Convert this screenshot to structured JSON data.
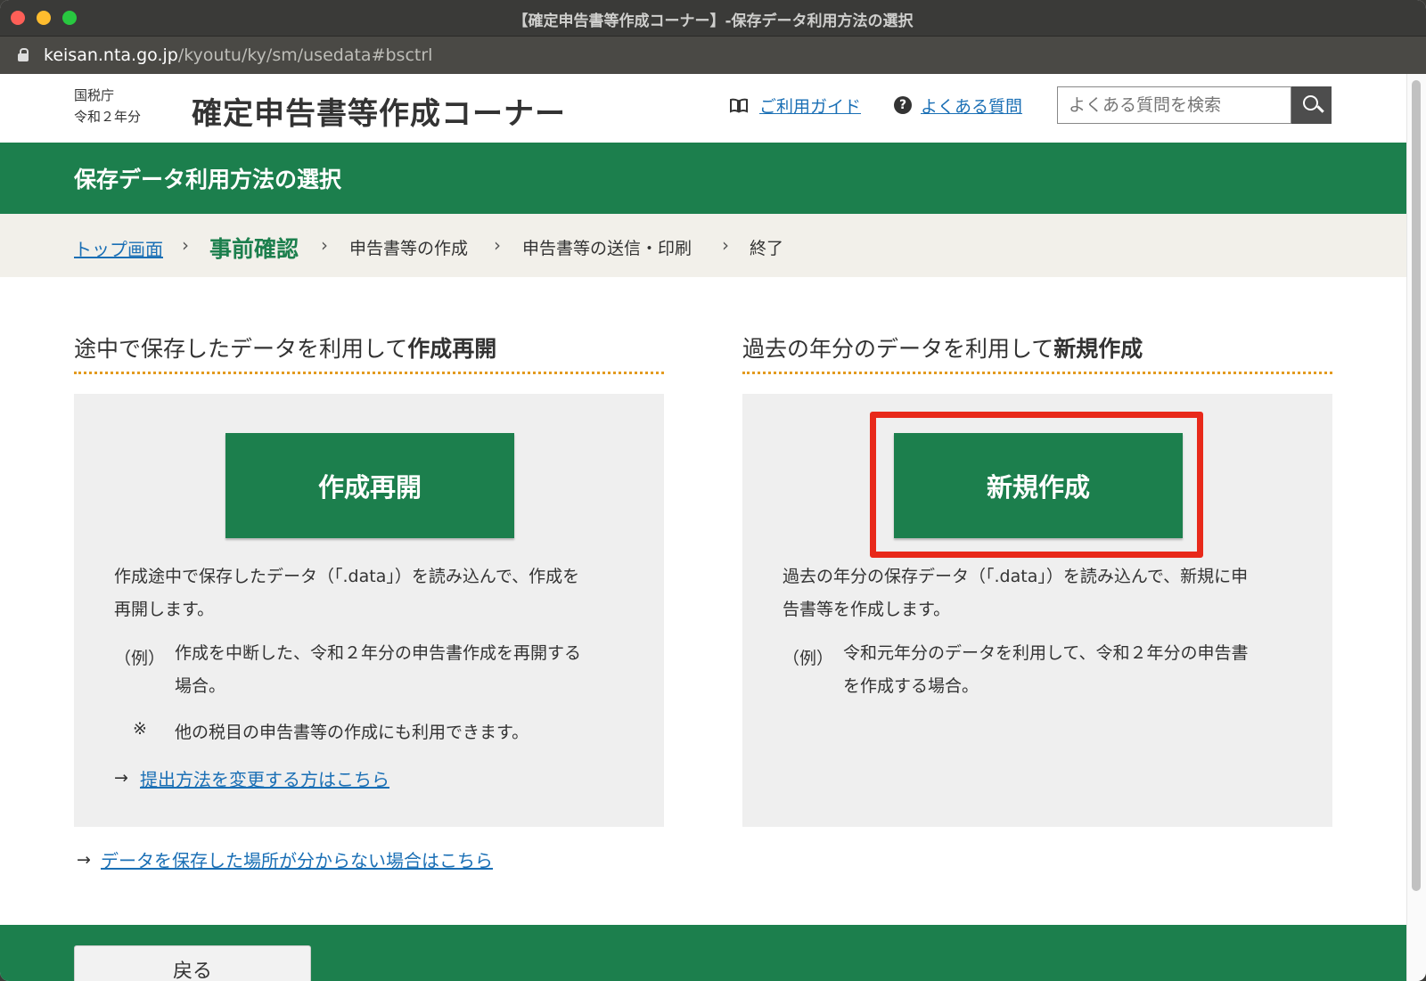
{
  "window": {
    "title": "【確定申告書等作成コーナー】-保存データ利用方法の選択",
    "url_host": "keisan.nta.go.jp",
    "url_path": "/kyoutu/ky/sm/usedata#bsctrl"
  },
  "header": {
    "agency": "国税庁",
    "year": "令和２年分",
    "site_title": "確定申告書等作成コーナー",
    "guide_link": "ご利用ガイド",
    "faq_link": "よくある質問",
    "search_placeholder": "よくある質問を検索"
  },
  "page": {
    "title": "保存データ利用方法の選択"
  },
  "breadcrumb": {
    "top": "トップ画面",
    "step1": "事前確認",
    "step2": "申告書等の作成",
    "step3": "申告書等の送信・印刷",
    "step4": "終了"
  },
  "resume": {
    "heading_prefix": "途中で保存したデータを利用して",
    "heading_bold": "作成再開",
    "button": "作成再開",
    "desc_line1": "作成途中で保存したデータ（「.data」）を読み込んで、作成を",
    "desc_line2": "再開します。",
    "example_label": "（例）",
    "example_line1": "作成を中断した、令和２年分の申告書作成を再開する",
    "example_line2": "場合。",
    "note_mark": "※",
    "note": "他の税目の申告書等の作成にも利用できます。",
    "change_link": "提出方法を変更する方はこちら"
  },
  "new": {
    "heading_prefix": "過去の年分のデータを利用して",
    "heading_bold": "新規作成",
    "button": "新規作成",
    "desc_line1": "過去の年分の保存データ（「.data」）を読み込んで、新規に申",
    "desc_line2": "告書等を作成します。",
    "example_label": "（例）",
    "example_line1": "令和元年分のデータを利用して、令和２年分の申告書",
    "example_line2": "を作成する場合。"
  },
  "misc": {
    "data_location_link": "データを保存した場所が分からない場合はこちら",
    "back_button": "戻る"
  },
  "colors": {
    "brand_green": "#1c7f4d",
    "link_blue": "#1a6fb5",
    "highlight_red": "#e8291a",
    "rule_orange": "#e39a1f"
  }
}
